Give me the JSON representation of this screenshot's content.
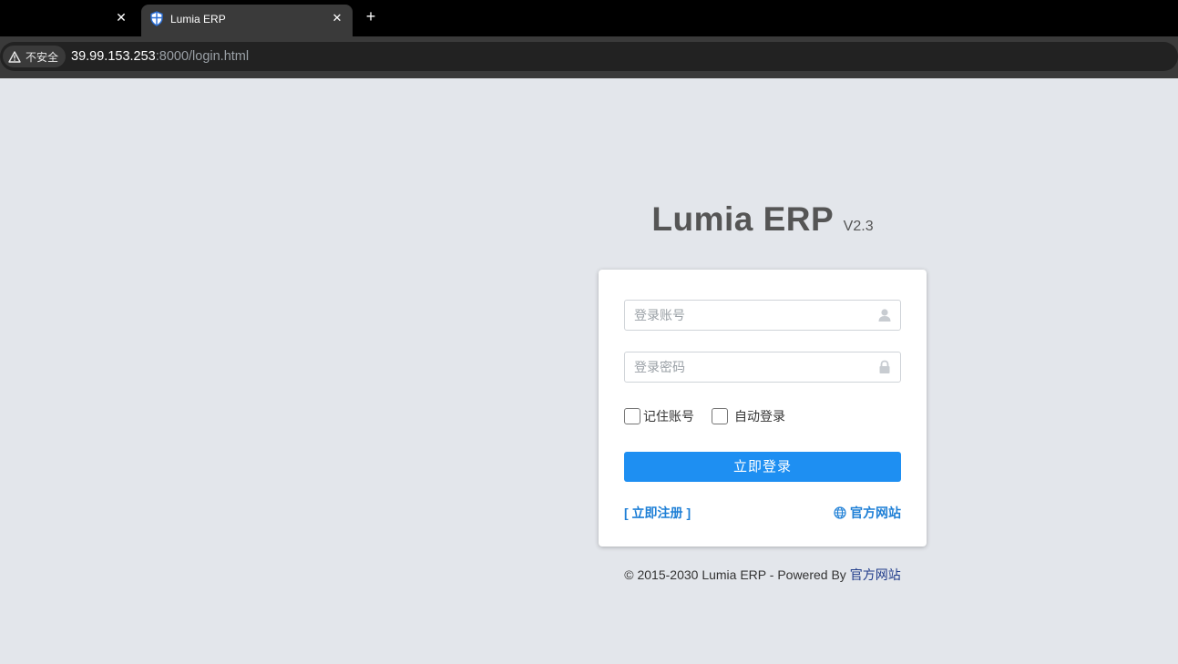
{
  "browser": {
    "prev_tab_close": "✕",
    "active_tab": {
      "title": "Lumia ERP",
      "close": "✕"
    },
    "new_tab": "+",
    "address": {
      "security_label": "不安全",
      "url_host": "39.99.153.253",
      "url_rest": ":8000/login.html"
    }
  },
  "brand": {
    "name": "Lumia ERP",
    "version": "V2.3"
  },
  "login": {
    "username_placeholder": "登录账号",
    "password_placeholder": "登录密码",
    "remember_label": "记住账号",
    "autologin_label": "自动登录",
    "submit_label": "立即登录",
    "register_label": "[ 立即注册 ]",
    "official_label": "官方网站"
  },
  "footer": {
    "text": "© 2015-2030 Lumia ERP - Powered By ",
    "link": "官方网站"
  },
  "colors": {
    "page_bg": "#e3e6eb",
    "primary": "#1e8ff2",
    "link": "#1e7fd6",
    "footer_link": "#1f3b8a"
  }
}
